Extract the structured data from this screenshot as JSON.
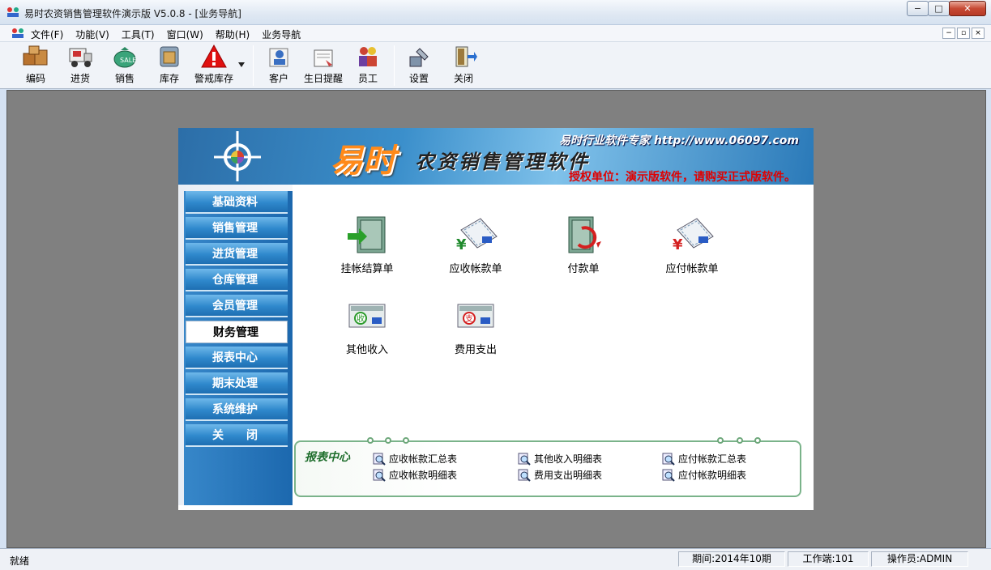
{
  "window": {
    "title": "易时农资销售管理软件演示版 V5.0.8 - [业务导航]",
    "minimize": "−",
    "maximize": "□",
    "close": "✕"
  },
  "menu": [
    "文件(F)",
    "功能(V)",
    "工具(T)",
    "窗口(W)",
    "帮助(H)",
    "业务导航"
  ],
  "mdi_controls": [
    "−",
    "▫",
    "×"
  ],
  "toolbar": {
    "items": [
      {
        "label": "编码",
        "icon": "boxes-icon"
      },
      {
        "label": "进货",
        "icon": "delivery-truck-icon"
      },
      {
        "label": "销售",
        "icon": "money-bag-icon"
      },
      {
        "label": "库存",
        "icon": "warehouse-icon"
      },
      {
        "label": "警戒库存",
        "icon": "warning-icon"
      },
      {
        "label": "客户",
        "icon": "customer-icon"
      },
      {
        "label": "生日提醒",
        "icon": "birthday-icon"
      },
      {
        "label": "员工",
        "icon": "employee-icon"
      },
      {
        "label": "设置",
        "icon": "settings-icon"
      },
      {
        "label": "关闭",
        "icon": "exit-door-icon"
      }
    ]
  },
  "banner": {
    "brand": "易时",
    "product": "农资销售管理软件",
    "slogan": "易时行业软件专家 http://www.06097.com",
    "license": "授权单位：演示版软件，请购买正式版软件。"
  },
  "nav": {
    "items": [
      "基础资料",
      "销售管理",
      "进货管理",
      "仓库管理",
      "会员管理",
      "财务管理",
      "报表中心",
      "期末处理",
      "系统维护",
      "关　　闭"
    ],
    "active_index": 5
  },
  "modules": [
    {
      "label": "挂帐结算单",
      "icon": "safe-settlement-icon"
    },
    {
      "label": "应收帐款单",
      "icon": "receivable-ledger-icon"
    },
    {
      "label": "付款单",
      "icon": "payment-safe-icon"
    },
    {
      "label": "应付帐款单",
      "icon": "payable-ledger-icon"
    },
    {
      "label": "其他收入",
      "icon": "other-income-icon"
    },
    {
      "label": "费用支出",
      "icon": "expense-icon"
    }
  ],
  "reports": {
    "title": "报表中心",
    "links": [
      "应收帐款汇总表",
      "应收帐款明细表",
      "其他收入明细表",
      "费用支出明细表",
      "应付帐款汇总表",
      "应付帐款明细表"
    ]
  },
  "status": {
    "ready": "就绪",
    "period": "期间:2014年10期",
    "terminal": "工作端:101",
    "operator": "操作员:ADMIN"
  }
}
